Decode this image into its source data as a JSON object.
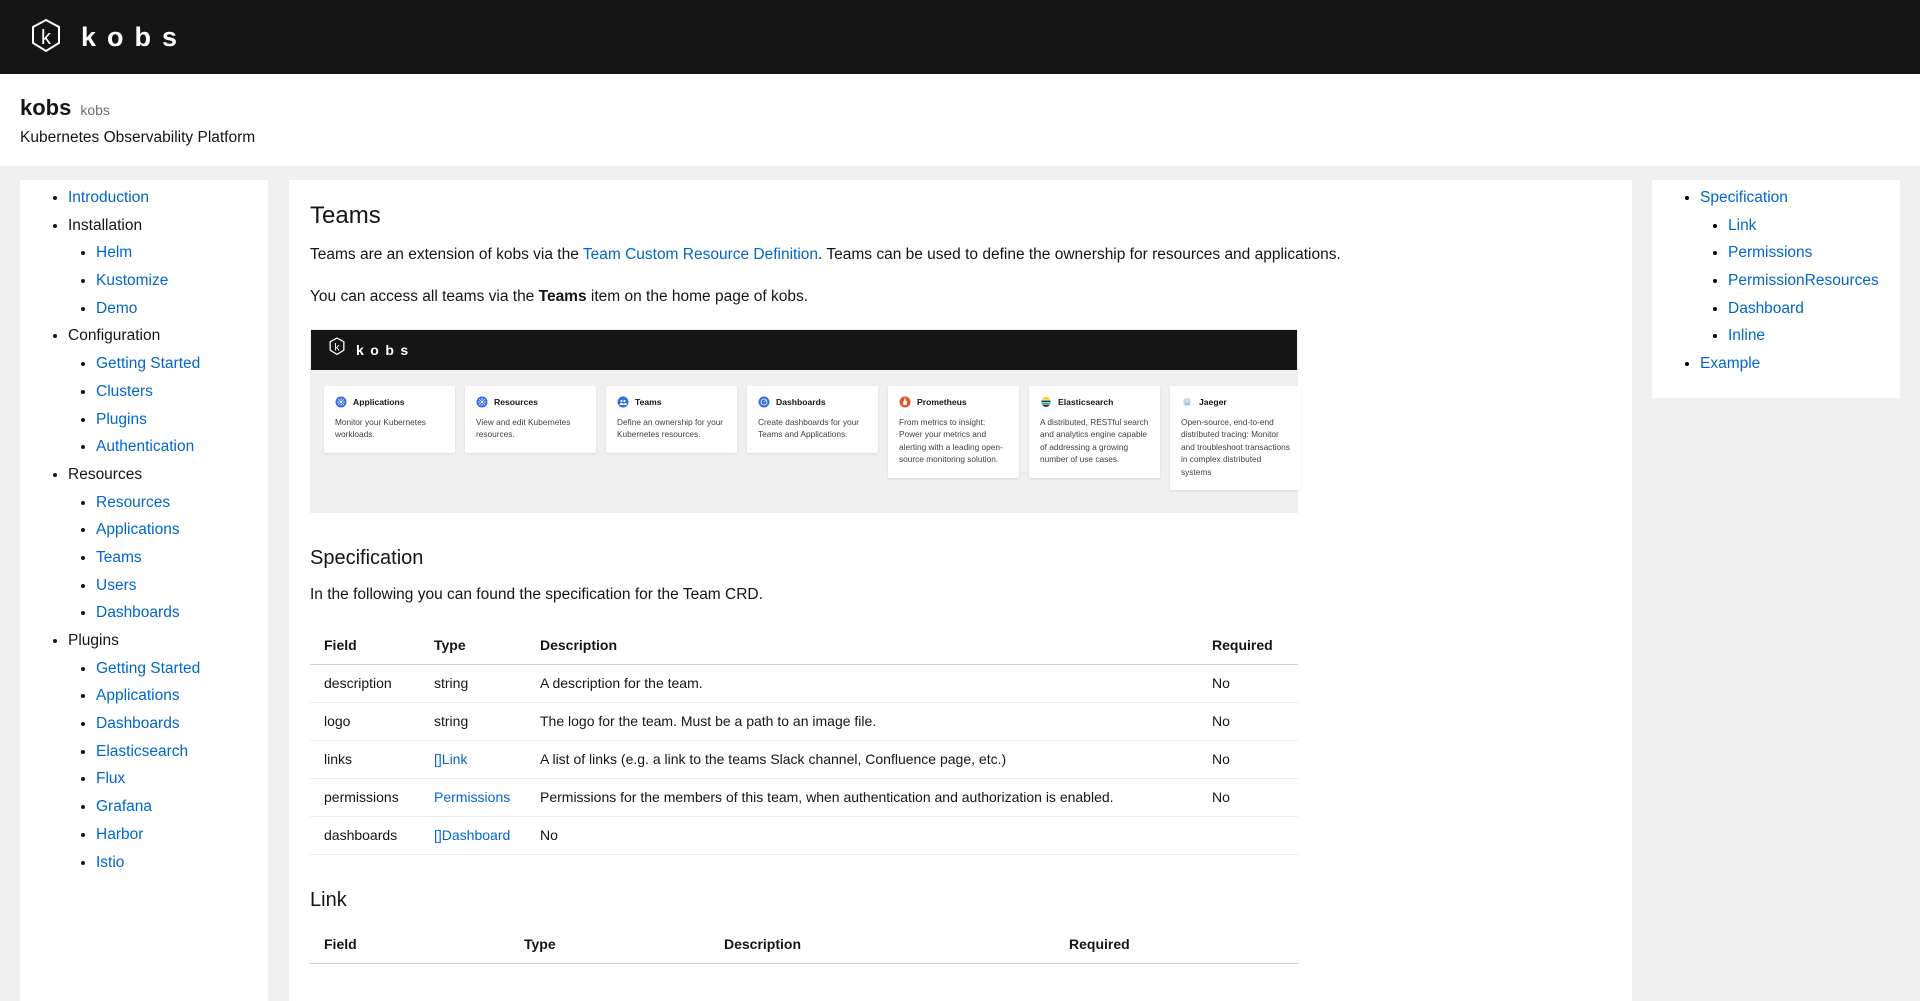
{
  "topbar": {
    "logo_icon": "kobs-hexagon-k-icon",
    "wordmark": "kobs"
  },
  "pagehead": {
    "title": "kobs",
    "subtitle": "kobs",
    "description": "Kubernetes Observability Platform"
  },
  "sidebar": {
    "items": [
      {
        "label": "Introduction",
        "link": true,
        "children": []
      },
      {
        "label": "Installation",
        "link": false,
        "children": [
          {
            "label": "Helm",
            "link": true
          },
          {
            "label": "Kustomize",
            "link": true
          },
          {
            "label": "Demo",
            "link": true
          }
        ]
      },
      {
        "label": "Configuration",
        "link": false,
        "children": [
          {
            "label": "Getting Started",
            "link": true
          },
          {
            "label": "Clusters",
            "link": true
          },
          {
            "label": "Plugins",
            "link": true
          },
          {
            "label": "Authentication",
            "link": true
          }
        ]
      },
      {
        "label": "Resources",
        "link": false,
        "children": [
          {
            "label": "Resources",
            "link": true
          },
          {
            "label": "Applications",
            "link": true
          },
          {
            "label": "Teams",
            "link": true
          },
          {
            "label": "Users",
            "link": true
          },
          {
            "label": "Dashboards",
            "link": true
          }
        ]
      },
      {
        "label": "Plugins",
        "link": false,
        "children": [
          {
            "label": "Getting Started",
            "link": true
          },
          {
            "label": "Applications",
            "link": true
          },
          {
            "label": "Dashboards",
            "link": true
          },
          {
            "label": "Elasticsearch",
            "link": true
          },
          {
            "label": "Flux",
            "link": true
          },
          {
            "label": "Grafana",
            "link": true
          },
          {
            "label": "Harbor",
            "link": true
          },
          {
            "label": "Istio",
            "link": true
          }
        ]
      }
    ]
  },
  "main": {
    "h1": "Teams",
    "intro_p1_before": "Teams are an extension of kobs via the ",
    "intro_p1_link": "Team Custom Resource Definition",
    "intro_p1_after": ". Teams can be used to define the ownership for resources and applications.",
    "intro_p2_before": "You can access all teams via the ",
    "intro_p2_bold": "Teams",
    "intro_p2_after": " item on the home page of kobs.",
    "screenshot": {
      "wordmark": "kobs",
      "logo_icon": "kobs-hexagon-k-icon",
      "cards": [
        {
          "title": "Applications",
          "icon": "kubernetes-applications-icon",
          "icon_color": "#326ce5",
          "text": "Monitor your Kubernetes workloads."
        },
        {
          "title": "Resources",
          "icon": "kubernetes-resources-icon",
          "icon_color": "#326ce5",
          "text": "View and edit Kubernetes resources."
        },
        {
          "title": "Teams",
          "icon": "teams-people-icon",
          "icon_color": "#326ce5",
          "text": "Define an ownership for your Kubernetes resources."
        },
        {
          "title": "Dashboards",
          "icon": "dashboards-gauge-icon",
          "icon_color": "#326ce5",
          "text": "Create dashboards for your Teams and Applications."
        },
        {
          "title": "Prometheus",
          "icon": "prometheus-flame-icon",
          "icon_color": "#e6522c",
          "text": "From metrics to insight: Power your metrics and alerting with a leading open-source monitoring solution."
        },
        {
          "title": "Elasticsearch",
          "icon": "elasticsearch-icon",
          "icon_color": "#fec514",
          "text": "A distributed, RESTful search and analytics engine capable of addressing a growing number of use cases."
        },
        {
          "title": "Jaeger",
          "icon": "jaeger-icon",
          "icon_color": "#60d0e4",
          "text": "Open-source, end-to-end distributed tracing: Monitor and troubleshoot transactions in complex distributed systems"
        }
      ]
    },
    "spec": {
      "heading": "Specification",
      "paragraph": "In the following you can found the specification for the Team CRD.",
      "columns": [
        "Field",
        "Type",
        "Description",
        "Required"
      ],
      "rows": [
        {
          "field": "description",
          "type": "string",
          "type_link": false,
          "description": "A description for the team.",
          "required": "No"
        },
        {
          "field": "logo",
          "type": "string",
          "type_link": false,
          "description": "The logo for the team. Must be a path to an image file.",
          "required": "No"
        },
        {
          "field": "links",
          "type": "[]Link",
          "type_link": true,
          "description": "A list of links (e.g. a link to the teams Slack channel, Confluence page, etc.)",
          "required": "No"
        },
        {
          "field": "permissions",
          "type": "Permissions",
          "type_link": true,
          "description": "Permissions for the members of this team, when authentication and authorization is enabled.",
          "required": "No"
        },
        {
          "field": "dashboards",
          "type": "[]Dashboard",
          "type_link": true,
          "description": "No",
          "required": ""
        }
      ]
    },
    "link_section": {
      "heading": "Link",
      "columns": [
        "Field",
        "Type",
        "Description",
        "Required"
      ]
    }
  },
  "toc": {
    "items": [
      {
        "label": "Specification",
        "children": [
          {
            "label": "Link"
          },
          {
            "label": "Permissions"
          },
          {
            "label": "PermissionResources"
          },
          {
            "label": "Dashboard"
          },
          {
            "label": "Inline"
          }
        ]
      },
      {
        "label": "Example",
        "children": []
      }
    ]
  },
  "colors": {
    "link": "#0066cc",
    "topbar_bg": "#151515",
    "page_bg": "#efefef"
  }
}
